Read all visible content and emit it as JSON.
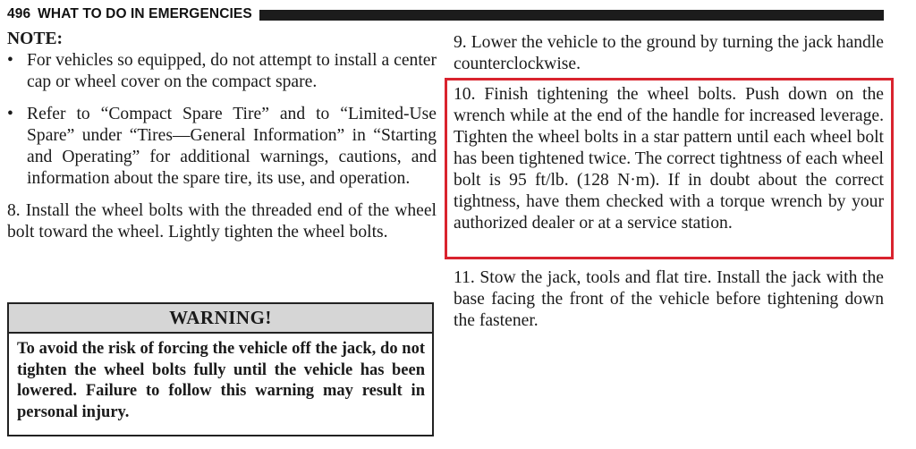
{
  "header": {
    "page_number": "496",
    "section_title": "WHAT TO DO IN EMERGENCIES"
  },
  "left_column": {
    "note_title": "NOTE:",
    "bullets": [
      "For vehicles so equipped, do not attempt to install a center cap or wheel cover on the compact spare.",
      "Refer to “Compact Spare Tire” and to “Limited-Use Spare” under “Tires—General Information” in “Starting and Operating” for additional warnings, cautions, and information about the spare tire, its use, and operation."
    ],
    "step_8": "8. Install the wheel bolts with the threaded end of the wheel bolt toward the wheel. Lightly tighten the wheel bolts."
  },
  "warning": {
    "title": "WARNING!",
    "body": "To avoid the risk of forcing the vehicle off the jack, do not tighten the wheel bolts fully until the vehicle has been lowered. Failure to follow this warning may result in personal injury."
  },
  "right_column": {
    "step_9": "9. Lower the vehicle to the ground by turning the jack handle counterclockwise.",
    "step_10": "10. Finish tightening the wheel bolts. Push down on the wrench while at the end of the handle for increased leverage. Tighten the wheel bolts in a star pattern until each wheel bolt has been tightened twice. The correct tightness of each wheel bolt is 95 ft/lb. (128 N·m). If in doubt about the correct tightness, have them checked with a torque wrench by your authorized dealer or at a service station.",
    "step_11": "11. Stow the jack, tools and flat tire. Install the jack with the base facing the front of the vehicle before tightening down the fastener."
  },
  "colors": {
    "highlight_border": "#d9232e",
    "header_bar": "#1c1c1c",
    "warning_header_bg": "#d6d6d6"
  }
}
